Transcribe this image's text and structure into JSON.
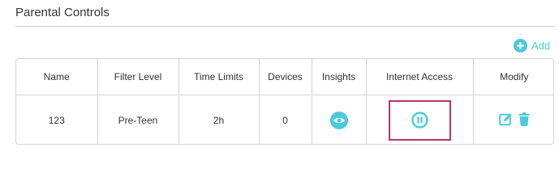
{
  "section": {
    "title": "Parental Controls"
  },
  "toolbar": {
    "add_label": "Add",
    "add_icon": "plus-circle-icon"
  },
  "table": {
    "columns": [
      "Name",
      "Filter Level",
      "Time Limits",
      "Devices",
      "Insights",
      "Internet Access",
      "Modify"
    ],
    "rows": [
      {
        "name": "123",
        "filter_level": "Pre-Teen",
        "time_limits": "2h",
        "devices": "0",
        "insights_icon": "eye-icon",
        "internet_access_icon": "pause-icon",
        "modify_icons": [
          "edit-icon",
          "trash-icon"
        ]
      }
    ]
  },
  "colors": {
    "accent": "#4acbd6",
    "highlight_border": "#b5356f",
    "border": "#d4d4d4",
    "text": "#333333"
  }
}
